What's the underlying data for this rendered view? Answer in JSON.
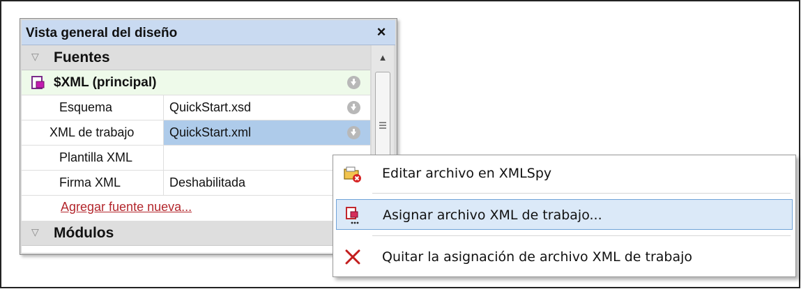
{
  "panel": {
    "title": "Vista general del diseño",
    "close_icon": "close-icon"
  },
  "sections": {
    "sources_label": "Fuentes",
    "modules_label": "Módulos"
  },
  "source": {
    "name": "$XML (principal)",
    "icon": "xml-file-icon"
  },
  "properties": [
    {
      "key": "Esquema",
      "value": "QuickStart.xsd"
    },
    {
      "key": "XML de trabajo",
      "value": "QuickStart.xml"
    },
    {
      "key": "Plantilla XML",
      "value": ""
    },
    {
      "key": "Firma XML",
      "value": "Deshabilitada"
    }
  ],
  "add_source_link": "Agregar fuente nueva...",
  "context_menu": {
    "items": [
      {
        "label": "Editar archivo en XMLSpy",
        "icon": "xmlspy-edit-icon"
      },
      {
        "label": "Asignar archivo XML de trabajo...",
        "icon": "assign-file-icon"
      },
      {
        "label": "Quitar la asignación de archivo XML de trabajo",
        "icon": "remove-x-icon"
      }
    ],
    "highlight_color": "#dbe9f8"
  },
  "colors": {
    "titlebar": "#c9daf1",
    "source_row": "#eefaea",
    "selected_value": "#aecbea",
    "link": "#b3272d"
  }
}
